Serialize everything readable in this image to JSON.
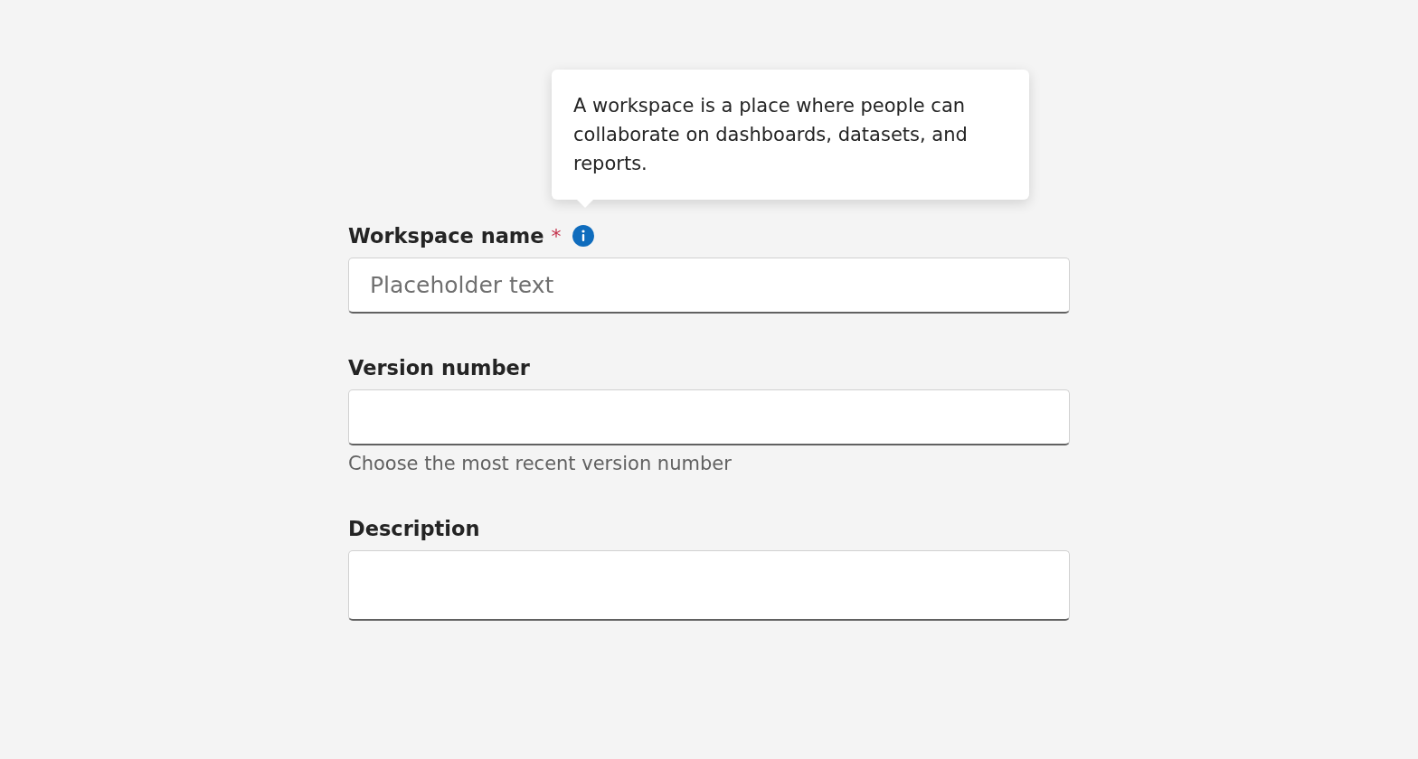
{
  "required_marker": "*",
  "fields": [
    {
      "kind": "input",
      "label": "Workspace name",
      "required": true,
      "tooltip": "A workspace is a place where people can collaborate on dashboards, datasets, and reports.",
      "placeholder": "Placeholder text"
    },
    {
      "kind": "input",
      "label": "Version number",
      "required": false,
      "helper": "Choose the most recent version number"
    },
    {
      "kind": "textarea",
      "label": "Description",
      "required": false
    }
  ]
}
